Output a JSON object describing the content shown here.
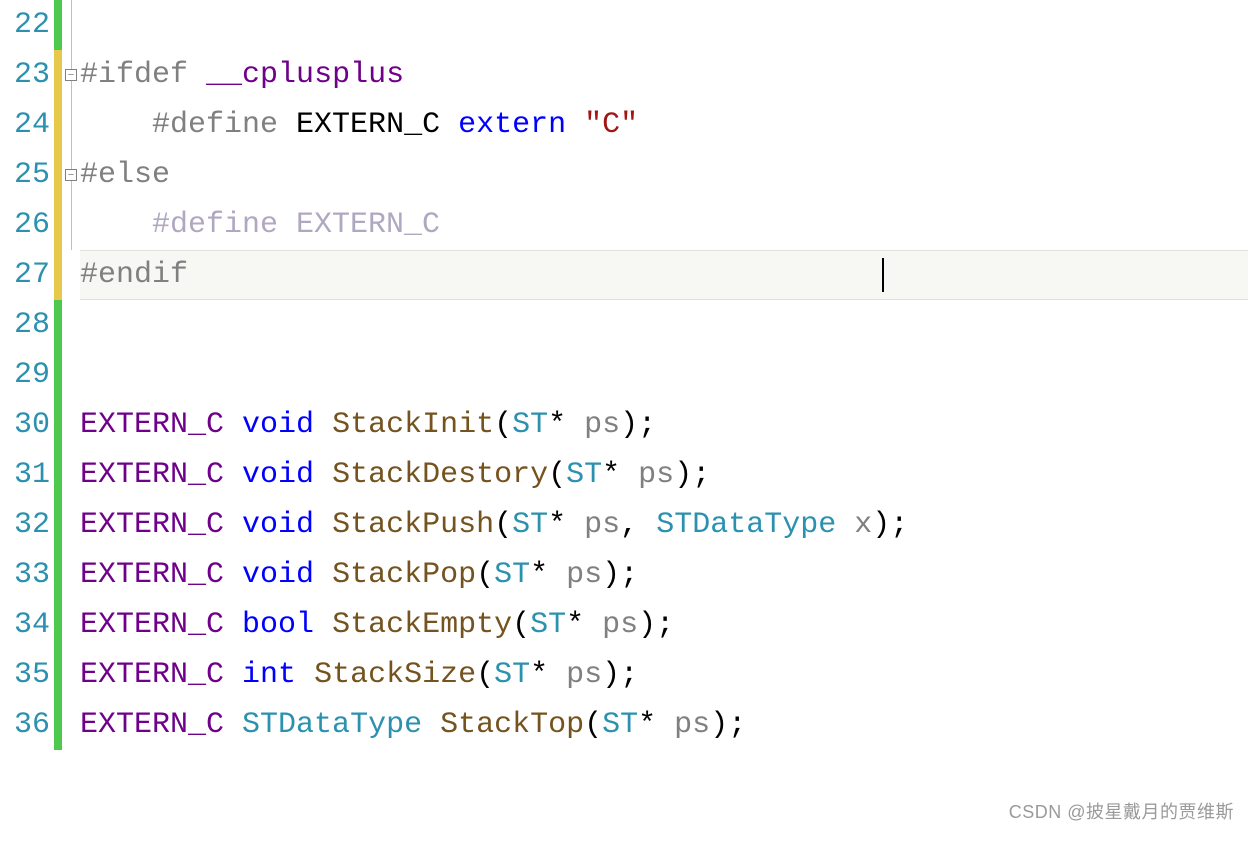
{
  "code": {
    "lines": [
      {
        "num": "22",
        "bar": "green",
        "fold": "line",
        "tokens": []
      },
      {
        "num": "23",
        "bar": "yellow",
        "fold": "box",
        "tokens": [
          {
            "cls": "tok-directive",
            "t": "#ifdef"
          },
          {
            "cls": "tok-plain",
            "t": " "
          },
          {
            "cls": "tok-macro",
            "t": "__cplusplus"
          }
        ]
      },
      {
        "num": "24",
        "bar": "yellow",
        "fold": "line",
        "tokens": [
          {
            "cls": "tok-plain",
            "t": "    "
          },
          {
            "cls": "tok-directive",
            "t": "#define"
          },
          {
            "cls": "tok-plain",
            "t": " EXTERN_C "
          },
          {
            "cls": "tok-keyword",
            "t": "extern"
          },
          {
            "cls": "tok-plain",
            "t": " "
          },
          {
            "cls": "tok-string",
            "t": "\"C\""
          }
        ]
      },
      {
        "num": "25",
        "bar": "yellow",
        "fold": "box",
        "tokens": [
          {
            "cls": "tok-directive",
            "t": "#else"
          }
        ]
      },
      {
        "num": "26",
        "bar": "yellow",
        "fold": "line",
        "tokens": [
          {
            "cls": "tok-plain",
            "t": "    "
          },
          {
            "cls": "tok-directive-dim",
            "t": "#define EXTERN_C"
          }
        ]
      },
      {
        "num": "27",
        "bar": "yellow",
        "fold": "none",
        "highlight": true,
        "tokens": [
          {
            "cls": "tok-directive",
            "t": "#endif"
          }
        ]
      },
      {
        "num": "28",
        "bar": "green",
        "fold": "none",
        "tokens": []
      },
      {
        "num": "29",
        "bar": "green",
        "fold": "none",
        "tokens": []
      },
      {
        "num": "30",
        "bar": "green",
        "fold": "none",
        "tokens": [
          {
            "cls": "tok-macro",
            "t": "EXTERN_C"
          },
          {
            "cls": "tok-plain",
            "t": " "
          },
          {
            "cls": "tok-keyword",
            "t": "void"
          },
          {
            "cls": "tok-plain",
            "t": " "
          },
          {
            "cls": "tok-func",
            "t": "StackInit"
          },
          {
            "cls": "tok-punct",
            "t": "("
          },
          {
            "cls": "tok-type",
            "t": "ST"
          },
          {
            "cls": "tok-punct",
            "t": "* "
          },
          {
            "cls": "tok-param",
            "t": "ps"
          },
          {
            "cls": "tok-punct",
            "t": ");"
          }
        ]
      },
      {
        "num": "31",
        "bar": "green",
        "fold": "none",
        "tokens": [
          {
            "cls": "tok-macro",
            "t": "EXTERN_C"
          },
          {
            "cls": "tok-plain",
            "t": " "
          },
          {
            "cls": "tok-keyword",
            "t": "void"
          },
          {
            "cls": "tok-plain",
            "t": " "
          },
          {
            "cls": "tok-func",
            "t": "StackDestory"
          },
          {
            "cls": "tok-punct",
            "t": "("
          },
          {
            "cls": "tok-type",
            "t": "ST"
          },
          {
            "cls": "tok-punct",
            "t": "* "
          },
          {
            "cls": "tok-param",
            "t": "ps"
          },
          {
            "cls": "tok-punct",
            "t": ");"
          }
        ]
      },
      {
        "num": "32",
        "bar": "green",
        "fold": "none",
        "tokens": [
          {
            "cls": "tok-macro",
            "t": "EXTERN_C"
          },
          {
            "cls": "tok-plain",
            "t": " "
          },
          {
            "cls": "tok-keyword",
            "t": "void"
          },
          {
            "cls": "tok-plain",
            "t": " "
          },
          {
            "cls": "tok-func",
            "t": "StackPush"
          },
          {
            "cls": "tok-punct",
            "t": "("
          },
          {
            "cls": "tok-type",
            "t": "ST"
          },
          {
            "cls": "tok-punct",
            "t": "* "
          },
          {
            "cls": "tok-param",
            "t": "ps"
          },
          {
            "cls": "tok-punct",
            "t": ", "
          },
          {
            "cls": "tok-type",
            "t": "STDataType"
          },
          {
            "cls": "tok-plain",
            "t": " "
          },
          {
            "cls": "tok-param",
            "t": "x"
          },
          {
            "cls": "tok-punct",
            "t": ");"
          }
        ]
      },
      {
        "num": "33",
        "bar": "green",
        "fold": "none",
        "tokens": [
          {
            "cls": "tok-macro",
            "t": "EXTERN_C"
          },
          {
            "cls": "tok-plain",
            "t": " "
          },
          {
            "cls": "tok-keyword",
            "t": "void"
          },
          {
            "cls": "tok-plain",
            "t": " "
          },
          {
            "cls": "tok-func",
            "t": "StackPop"
          },
          {
            "cls": "tok-punct",
            "t": "("
          },
          {
            "cls": "tok-type",
            "t": "ST"
          },
          {
            "cls": "tok-punct",
            "t": "* "
          },
          {
            "cls": "tok-param",
            "t": "ps"
          },
          {
            "cls": "tok-punct",
            "t": ");"
          }
        ]
      },
      {
        "num": "34",
        "bar": "green",
        "fold": "none",
        "tokens": [
          {
            "cls": "tok-macro",
            "t": "EXTERN_C"
          },
          {
            "cls": "tok-plain",
            "t": " "
          },
          {
            "cls": "tok-keyword",
            "t": "bool"
          },
          {
            "cls": "tok-plain",
            "t": " "
          },
          {
            "cls": "tok-func",
            "t": "StackEmpty"
          },
          {
            "cls": "tok-punct",
            "t": "("
          },
          {
            "cls": "tok-type",
            "t": "ST"
          },
          {
            "cls": "tok-punct",
            "t": "* "
          },
          {
            "cls": "tok-param",
            "t": "ps"
          },
          {
            "cls": "tok-punct",
            "t": ");"
          }
        ]
      },
      {
        "num": "35",
        "bar": "green",
        "fold": "none",
        "tokens": [
          {
            "cls": "tok-macro",
            "t": "EXTERN_C"
          },
          {
            "cls": "tok-plain",
            "t": " "
          },
          {
            "cls": "tok-keyword",
            "t": "int"
          },
          {
            "cls": "tok-plain",
            "t": " "
          },
          {
            "cls": "tok-func",
            "t": "StackSize"
          },
          {
            "cls": "tok-punct",
            "t": "("
          },
          {
            "cls": "tok-type",
            "t": "ST"
          },
          {
            "cls": "tok-punct",
            "t": "* "
          },
          {
            "cls": "tok-param",
            "t": "ps"
          },
          {
            "cls": "tok-punct",
            "t": ");"
          }
        ]
      },
      {
        "num": "36",
        "bar": "green",
        "fold": "none",
        "tokens": [
          {
            "cls": "tok-macro",
            "t": "EXTERN_C"
          },
          {
            "cls": "tok-plain",
            "t": " "
          },
          {
            "cls": "tok-type",
            "t": "STDataType"
          },
          {
            "cls": "tok-plain",
            "t": " "
          },
          {
            "cls": "tok-func",
            "t": "StackTop"
          },
          {
            "cls": "tok-punct",
            "t": "("
          },
          {
            "cls": "tok-type",
            "t": "ST"
          },
          {
            "cls": "tok-punct",
            "t": "* "
          },
          {
            "cls": "tok-param",
            "t": "ps"
          },
          {
            "cls": "tok-punct",
            "t": ");"
          }
        ]
      }
    ]
  },
  "fold_glyph": "−",
  "watermark": "CSDN @披星戴月的贾维斯"
}
